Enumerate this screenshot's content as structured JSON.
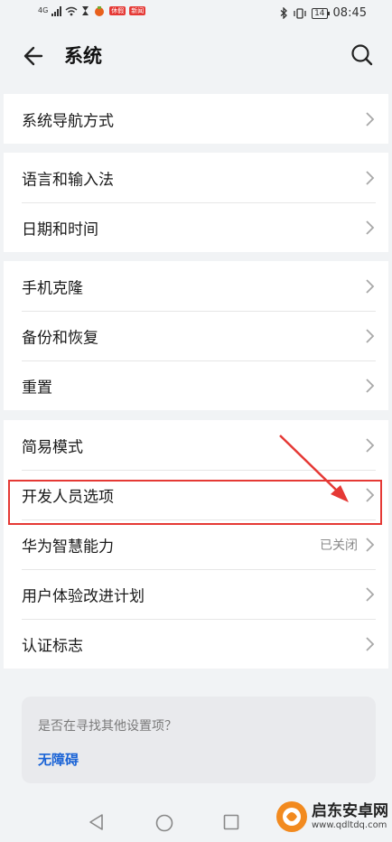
{
  "status_bar": {
    "network_label": "4G",
    "notification_badge": "休假",
    "notification_badge2": "新闻",
    "battery": "14",
    "time": "08:45"
  },
  "header": {
    "title": "系统"
  },
  "groups": [
    {
      "items": [
        {
          "label": "系统导航方式",
          "value": ""
        }
      ]
    },
    {
      "items": [
        {
          "label": "语言和输入法",
          "value": ""
        },
        {
          "label": "日期和时间",
          "value": ""
        }
      ]
    },
    {
      "items": [
        {
          "label": "手机克隆",
          "value": ""
        },
        {
          "label": "备份和恢复",
          "value": ""
        },
        {
          "label": "重置",
          "value": ""
        }
      ]
    },
    {
      "items": [
        {
          "label": "简易模式",
          "value": ""
        },
        {
          "label": "开发人员选项",
          "value": ""
        },
        {
          "label": "华为智慧能力",
          "value": "已关闭"
        },
        {
          "label": "用户体验改进计划",
          "value": ""
        },
        {
          "label": "认证标志",
          "value": ""
        }
      ]
    }
  ],
  "search_suggestion": {
    "question": "是否在寻找其他设置项？",
    "link": "无障碍"
  },
  "watermark": {
    "name": "启东安卓网",
    "url": "www.qdltdq.com"
  },
  "colors": {
    "highlight": "#e53935",
    "link": "#1a63d6",
    "background": "#f1f3f5"
  }
}
